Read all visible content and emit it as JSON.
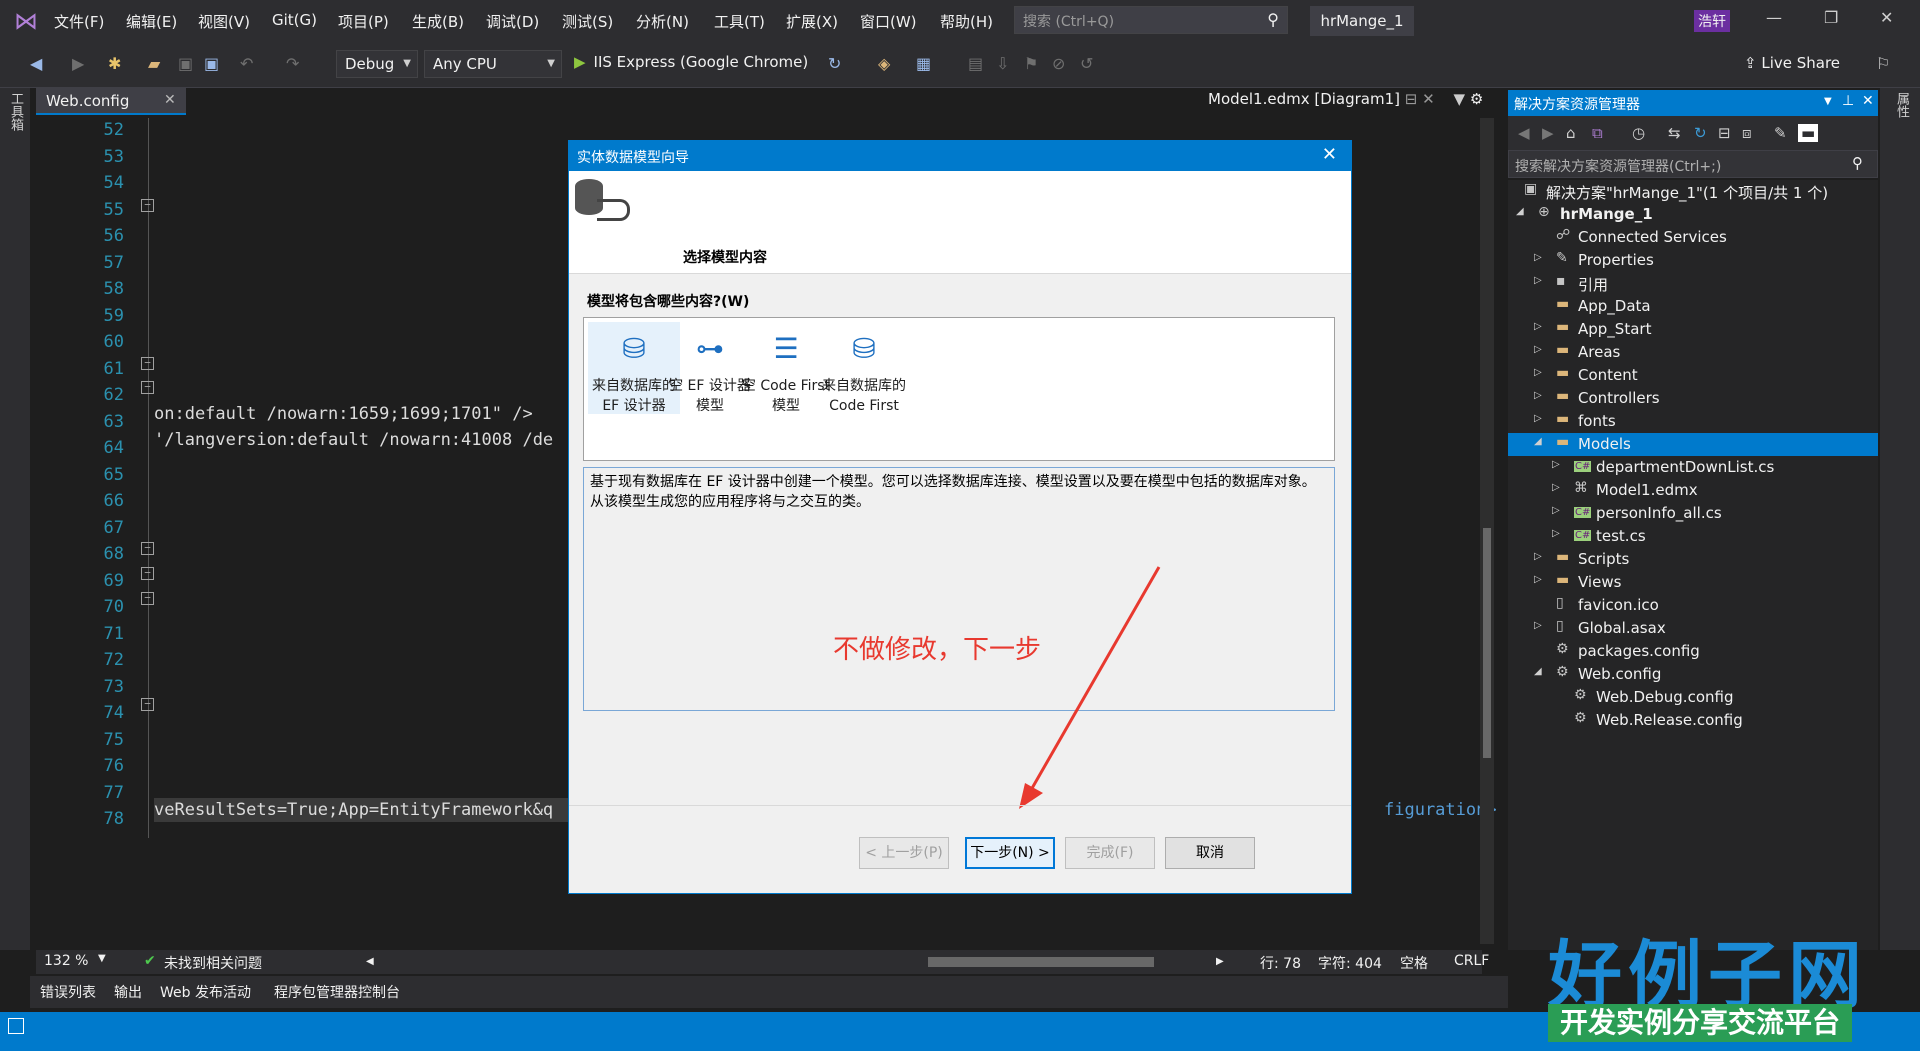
{
  "menubar": {
    "items": [
      "文件(F)",
      "编辑(E)",
      "视图(V)",
      "Git(G)",
      "项目(P)",
      "生成(B)",
      "调试(D)",
      "测试(S)",
      "分析(N)",
      "工具(T)",
      "扩展(X)",
      "窗口(W)",
      "帮助(H)"
    ],
    "search_placeholder": "搜索 (Ctrl+Q)",
    "project_title": "hrMange_1",
    "user_badge": "浩轩"
  },
  "toolbar": {
    "config": "Debug",
    "platform": "Any CPU",
    "run_label": "IIS Express (Google Chrome)",
    "live_share": "Live Share"
  },
  "toolbox_label": "工具箱",
  "properties_label": "属性",
  "editor": {
    "tab_active": "Web.config",
    "tab_other": "Model1.edmx [Diagram1]",
    "line_numbers": [
      "52",
      "53",
      "54",
      "55",
      "56",
      "57",
      "58",
      "59",
      "60",
      "61",
      "62",
      "63",
      "64",
      "65",
      "66",
      "67",
      "68",
      "69",
      "70",
      "71",
      "72",
      "73",
      "74",
      "75",
      "76",
      "77",
      "78"
    ],
    "code_63": "on:default /nowarn:1659;1699;1701\" />",
    "code_64": "'/langversion:default /nowarn:41008 /de",
    "code_78": "veResultSets=True;App=EntityFramework&q",
    "code_78_right": "figuration>",
    "zoom": "132 %",
    "issues": "未找到相关问题",
    "line": "行: 78",
    "char": "字符: 404",
    "whitespace": "空格",
    "eol": "CRLF"
  },
  "bottom_tabs": [
    "错误列表",
    "输出",
    "Web 发布活动",
    "程序包管理器控制台"
  ],
  "solution_explorer": {
    "title": "解决方案资源管理器",
    "search_placeholder": "搜索解决方案资源管理器(Ctrl+;)",
    "items": [
      {
        "label": "解决方案\"hrMange_1\"(1 个项目/共 1 个)",
        "icon": "solution-icon"
      },
      {
        "label": "hrMange_1",
        "icon": "project-icon"
      },
      {
        "label": "Connected Services",
        "icon": "connected-icon"
      },
      {
        "label": "Properties",
        "icon": "wrench-icon"
      },
      {
        "label": "引用",
        "icon": "references-icon"
      },
      {
        "label": "App_Data",
        "icon": "folder-icon"
      },
      {
        "label": "App_Start",
        "icon": "folder-icon"
      },
      {
        "label": "Areas",
        "icon": "folder-icon"
      },
      {
        "label": "Content",
        "icon": "folder-icon"
      },
      {
        "label": "Controllers",
        "icon": "folder-icon"
      },
      {
        "label": "fonts",
        "icon": "folder-icon"
      },
      {
        "label": "Models",
        "icon": "folder-icon"
      },
      {
        "label": "departmentDownList.cs",
        "icon": "csharp-icon"
      },
      {
        "label": "Model1.edmx",
        "icon": "edmx-icon"
      },
      {
        "label": "personInfo_all.cs",
        "icon": "csharp-icon"
      },
      {
        "label": "test.cs",
        "icon": "csharp-icon"
      },
      {
        "label": "Scripts",
        "icon": "folder-icon"
      },
      {
        "label": "Views",
        "icon": "folder-icon"
      },
      {
        "label": "favicon.ico",
        "icon": "file-icon"
      },
      {
        "label": "Global.asax",
        "icon": "file-icon"
      },
      {
        "label": "packages.config",
        "icon": "config-icon"
      },
      {
        "label": "Web.config",
        "icon": "config-icon"
      },
      {
        "label": "Web.Debug.config",
        "icon": "config-icon"
      },
      {
        "label": "Web.Release.config",
        "icon": "config-icon"
      }
    ]
  },
  "dialog": {
    "title": "实体数据模型向导",
    "heading": "选择模型内容",
    "question": "模型将包含哪些内容?(W)",
    "options": [
      {
        "line1": "来自数据库的",
        "line2": "EF 设计器"
      },
      {
        "line1": "空 EF 设计器",
        "line2": "模型"
      },
      {
        "line1": "空 Code First",
        "line2": "模型"
      },
      {
        "line1": "来自数据库的",
        "line2": "Code First"
      }
    ],
    "description": "基于现有数据库在 EF 设计器中创建一个模型。您可以选择数据库连接、模型设置以及要在模型中包括的数据库对象。从该模型生成您的应用程序将与之交互的类。",
    "annotation": "不做修改，下一步",
    "buttons": {
      "prev": "< 上一步(P)",
      "next": "下一步(N) >",
      "finish": "完成(F)",
      "cancel": "取消"
    }
  },
  "brand": {
    "main": "好例子网",
    "sub": "开发实例分享交流平台"
  }
}
